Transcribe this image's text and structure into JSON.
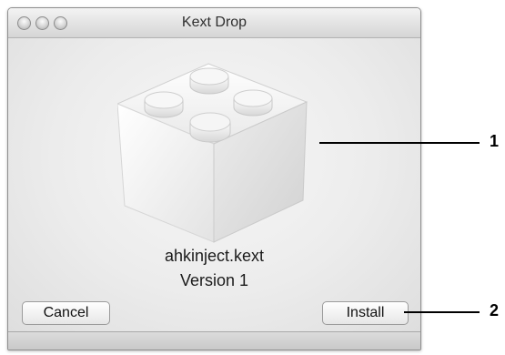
{
  "window": {
    "title": "Kext Drop"
  },
  "traffic_lights": [
    "close",
    "minimize",
    "zoom"
  ],
  "icon": {
    "name": "lego-brick-kext-icon"
  },
  "kext": {
    "name": "ahkinject.kext",
    "version": "Version 1"
  },
  "buttons": {
    "cancel": "Cancel",
    "install": "Install"
  },
  "callouts": {
    "one": "1",
    "two": "2"
  }
}
